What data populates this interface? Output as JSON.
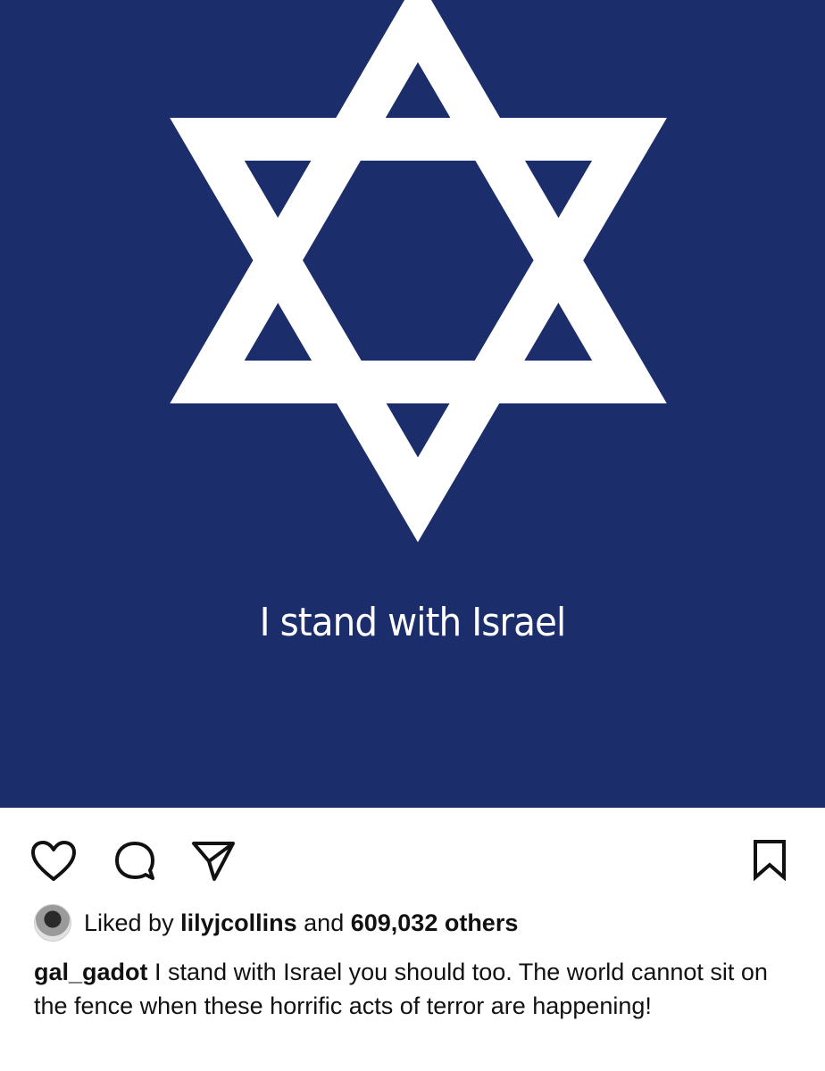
{
  "post": {
    "image_text": "I stand with Israel",
    "image_bg_color": "#1c2d6c",
    "image_fg_color": "#ffffff",
    "image_symbol": "star-of-david-icon"
  },
  "actions": {
    "like_icon": "heart-icon",
    "comment_icon": "comment-bubble-icon",
    "share_icon": "paper-plane-icon",
    "save_icon": "bookmark-icon"
  },
  "likes": {
    "prefix": "Liked by",
    "user": "lilyjcollins",
    "middle": "and",
    "count": "609,032 others"
  },
  "caption": {
    "username": "gal_gadot",
    "text": "I stand with Israel you should too. The world cannot sit on the fence when these horrific acts of terror are happening!"
  }
}
